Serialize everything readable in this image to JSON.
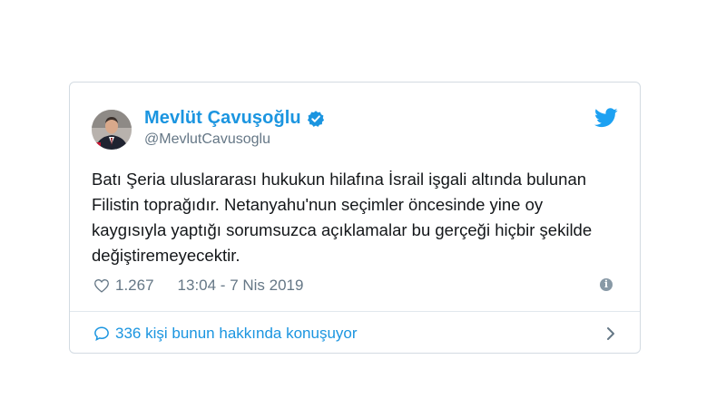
{
  "tweet": {
    "author_name": "Mevlüt Çavuşoğlu",
    "author_handle": "@MevlutCavusoglu",
    "text": "Batı Şeria uluslararası hukukun hilafına İsrail işgali altında bulunan Filistin toprağıdır. Netanyahu'nun seçimler öncesinde yine oy kaygısıyla yaptığı sorumsuzca açıklamalar bu gerçeği hiçbir şekilde değiştiremeyecektir.",
    "likes": "1.267",
    "timestamp": "13:04 - 7 Nis 2019",
    "conversation": "336 kişi bunun hakkında konuşuyor"
  },
  "icons": {
    "verified": "verified-badge-icon",
    "brand": "twitter-bird-icon",
    "like": "heart-icon",
    "info": "info-icon",
    "reply": "speech-bubble-icon",
    "chevron": "chevron-right-icon"
  },
  "colors": {
    "accent": "#1b95e0",
    "text": "#14171a",
    "muted": "#657786",
    "border": "#d3dbe2"
  }
}
